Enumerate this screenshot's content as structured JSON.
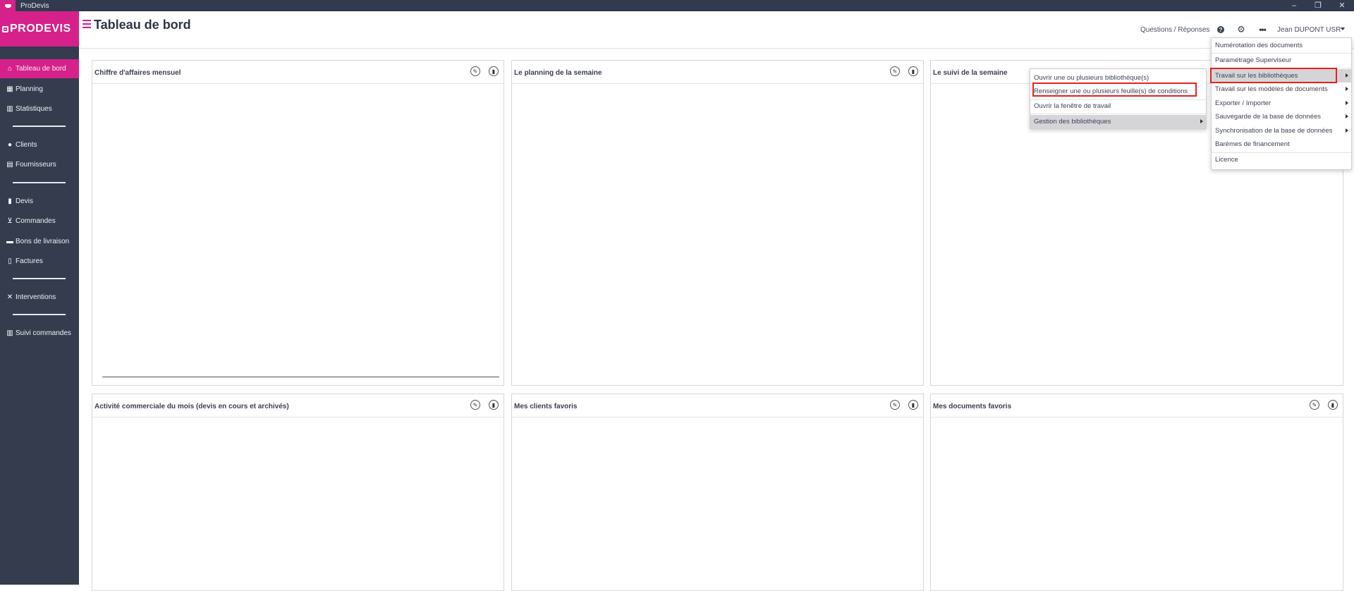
{
  "window": {
    "title": "ProDevis",
    "controls": [
      "–",
      "❐",
      "✕"
    ]
  },
  "brand": {
    "logo_text": "PRODEVIS",
    "accent": "#d6218a",
    "sidebar_bg": "#343c4e"
  },
  "sidebar": {
    "items": [
      {
        "label": "Tableau de bord",
        "icon": "home-icon",
        "active": true
      },
      {
        "label": "Planning",
        "icon": "calendar-icon"
      },
      {
        "label": "Statistiques",
        "icon": "chart-icon"
      },
      {
        "label": "Clients",
        "icon": "user-icon"
      },
      {
        "label": "Fournisseurs",
        "icon": "building-icon"
      },
      {
        "label": "Devis",
        "icon": "document-icon"
      },
      {
        "label": "Commandes",
        "icon": "cart-icon"
      },
      {
        "label": "Bons de livraison",
        "icon": "truck-icon"
      },
      {
        "label": "Factures",
        "icon": "invoice-icon"
      },
      {
        "label": "Interventions",
        "icon": "tools-icon"
      },
      {
        "label": "Suivi commandes",
        "icon": "chart-icon"
      }
    ]
  },
  "header": {
    "title": "Tableau de bord",
    "qa_link": "Questions / Réponses",
    "user": "Jean DUPONT USR"
  },
  "widgets": [
    {
      "title": "Chiffre d'affaires mensuel"
    },
    {
      "title": "Le planning de la semaine"
    },
    {
      "title": "Le suivi de la semaine"
    },
    {
      "title": "Activité commerciale du mois (devis en cours et archivés)"
    },
    {
      "title": "Mes clients favoris"
    },
    {
      "title": "Mes documents favoris"
    }
  ],
  "settings_menu": {
    "items": [
      {
        "label": "Numérotation des documents"
      },
      {
        "label": "Paramétrage Superviseur"
      },
      {
        "label": "Travail sur les bibliothèques",
        "submenu": true,
        "highlighted": true
      },
      {
        "label": "Travail sur les modèles de documents",
        "submenu": true
      },
      {
        "label": "Exporter / Importer",
        "submenu": true
      },
      {
        "label": "Sauvegarde de la base de données",
        "submenu": true
      },
      {
        "label": "Synchronisation de la base de données",
        "submenu": true
      },
      {
        "label": "Barèmes de financement"
      },
      {
        "label": "Licence"
      }
    ]
  },
  "library_submenu": {
    "items": [
      {
        "label": "Ouvrir une ou plusieurs bibliothèque(s)"
      },
      {
        "label": "Renseigner une ou plusieurs feuille(s) de conditions",
        "boxed": true
      },
      {
        "label": "Ouvrir la fenêtre de travail"
      },
      {
        "label": "Gestion des bibliothèques",
        "submenu": true,
        "highlighted": true
      }
    ]
  }
}
